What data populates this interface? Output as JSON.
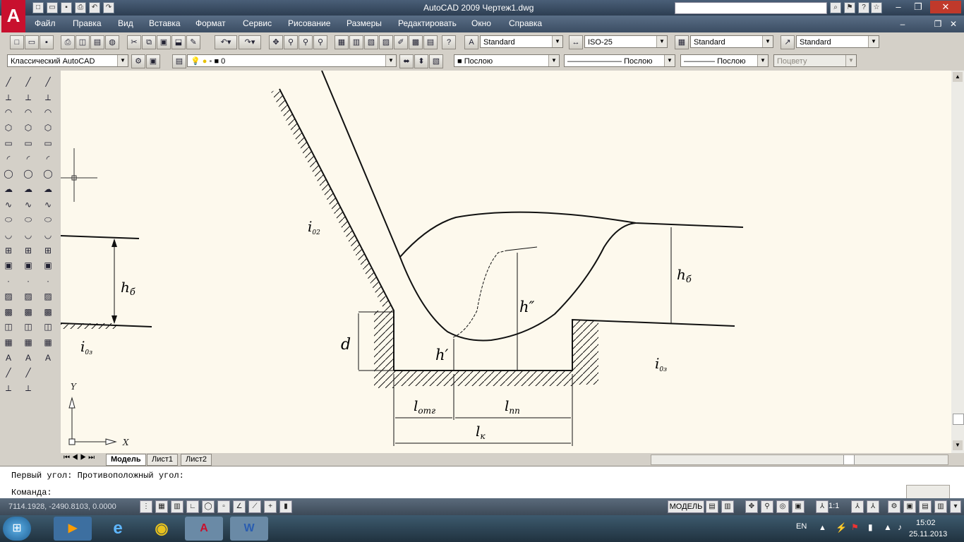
{
  "window": {
    "title": "AutoCAD 2009 Чертеж1.dwg",
    "logo": "A"
  },
  "menu": {
    "items": [
      "Файл",
      "Правка",
      "Вид",
      "Вставка",
      "Формат",
      "Сервис",
      "Рисование",
      "Размеры",
      "Редактировать",
      "Окно",
      "Справка"
    ]
  },
  "styles_toolbar": {
    "text_style": "Standard",
    "dim_style": "ISO-25",
    "table_style": "Standard",
    "mleader_style": "Standard"
  },
  "workspace_toolbar": {
    "workspace": "Классический AutoCAD",
    "layer": "0",
    "color": "Послою",
    "linetype": "Послою",
    "lineweight": "Послою",
    "plotstyle": "Поцвету"
  },
  "layout_tabs": [
    "Модель",
    "Лист1",
    "Лист2"
  ],
  "command_history": [
    "Первый угол: Противоположный угол:"
  ],
  "command_prompt": "Команда:",
  "status": {
    "coordinates": "7114.1928, -2490.8103, 0.0000",
    "model_label": "МОДЕЛЬ",
    "scale": "1:1"
  },
  "taskbar": {
    "language": "EN",
    "time": "15:02",
    "date": "25.11.2013"
  },
  "ucs": {
    "x_label": "X",
    "y_label": "Y"
  },
  "drawing_labels": {
    "h_b_left": "h",
    "h_b_left_sub": "б",
    "h_b_right": "h",
    "h_b_right_sub": "б",
    "i_left": "i",
    "i_left_sub": "0з",
    "i_right": "i",
    "i_right_sub": "0з",
    "i_top": "i",
    "i_top_sub": "02",
    "d": "d",
    "h_prime": "h′",
    "h_dprime": "h″",
    "l_otg": "l",
    "l_otg_sub": "отг",
    "l_pp": "l",
    "l_pp_sub": "пп",
    "l_k": "l",
    "l_k_sub": "к"
  },
  "colors": {
    "canvas": "#fdf9ed",
    "titlebar": "#3b4d63",
    "logo": "#c8102e"
  }
}
